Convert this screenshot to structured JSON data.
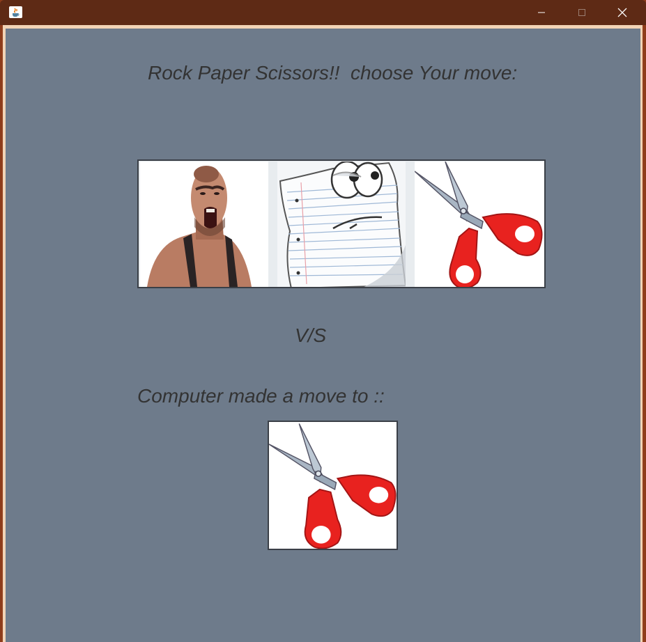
{
  "window": {
    "title": "",
    "app_icon": "java-icon",
    "controls": {
      "minimize_icon": "minimize-icon",
      "maximize_icon": "maximize-icon",
      "close_icon": "close-icon"
    }
  },
  "game": {
    "prompt": "Rock Paper Scissors!!  choose Your move:",
    "choices": [
      {
        "name": "rock",
        "icon": "rock-image"
      },
      {
        "name": "paper",
        "icon": "paper-image"
      },
      {
        "name": "scissors",
        "icon": "scissors-image"
      }
    ],
    "versus": "V/S",
    "computer_label": "Computer made a move to ::",
    "computer_move": {
      "name": "scissors",
      "icon": "scissors-image"
    }
  },
  "colors": {
    "titlebar": "#5e2a15",
    "background": "#6e7b8b",
    "text": "#333333",
    "scissors_handle": "#e8221f",
    "scissors_blade": "#9aa9b8"
  }
}
